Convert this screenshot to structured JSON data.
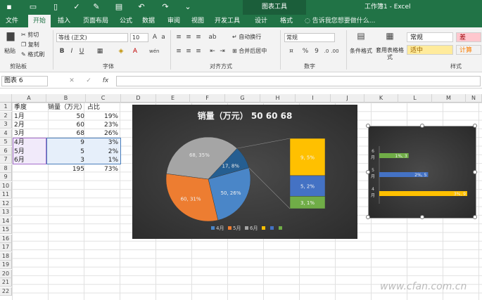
{
  "titlebar": {
    "chart_tools": "图表工具",
    "window_title": "工作簿1 - Excel"
  },
  "tabs": [
    {
      "label": "文件"
    },
    {
      "label": "开始"
    },
    {
      "label": "插入"
    },
    {
      "label": "页面布局"
    },
    {
      "label": "公式"
    },
    {
      "label": "数据"
    },
    {
      "label": "审阅"
    },
    {
      "label": "视图"
    },
    {
      "label": "开发工具"
    },
    {
      "label": "设计"
    },
    {
      "label": "格式"
    }
  ],
  "tellme": "告诉我您想要做什么...",
  "ribbon": {
    "clipboard": {
      "paste": "粘贴",
      "cut": "剪切",
      "copy": "复制",
      "format_painter": "格式刷",
      "label": "剪贴板"
    },
    "font": {
      "name": "等线 (正文)",
      "size": "10",
      "bold": "B",
      "italic": "I",
      "underline": "U",
      "label": "字体",
      "grow": "A",
      "wen": "wén"
    },
    "alignment": {
      "wrap": "自动换行",
      "merge": "合并后居中",
      "label": "对齐方式"
    },
    "number": {
      "format": "常规",
      "label": "数字",
      "percent": "%",
      "comma": "9"
    },
    "styles": {
      "conditional": "条件格式",
      "table": "套用表格格式",
      "normal": "常规",
      "bad": "差",
      "neutral": "适中",
      "calc": "计算",
      "label": "样式"
    }
  },
  "formula_bar": {
    "name_box": "图表 6",
    "cancel": "✕",
    "enter": "✓",
    "fx": "fx"
  },
  "columns": [
    "A",
    "B",
    "C",
    "D",
    "E",
    "F",
    "G",
    "H",
    "I",
    "J",
    "K",
    "L",
    "M",
    "N"
  ],
  "rows": [
    "1",
    "2",
    "3",
    "4",
    "5",
    "6",
    "7",
    "8",
    "9",
    "10",
    "11",
    "12",
    "13",
    "14",
    "15",
    "16",
    "17",
    "18",
    "19",
    "20",
    "21",
    "22"
  ],
  "sheet": {
    "header": {
      "a": "季度",
      "b": "销量（万元）",
      "c": "占比"
    },
    "data": [
      {
        "a": "1月",
        "b": "50",
        "c": "19%"
      },
      {
        "a": "2月",
        "b": "60",
        "c": "23%"
      },
      {
        "a": "3月",
        "b": "68",
        "c": "26%"
      },
      {
        "a": "4月",
        "b": "9",
        "c": "3%"
      },
      {
        "a": "5月",
        "b": "5",
        "c": "2%"
      },
      {
        "a": "6月",
        "b": "3",
        "c": "1%"
      }
    ],
    "total": {
      "b": "195",
      "c": "73%"
    }
  },
  "chart_data": [
    {
      "type": "pie",
      "title": "销量（万元） 50 60 68",
      "slices": [
        {
          "label": "50, 26%",
          "value": 50,
          "color": "#4a86c8"
        },
        {
          "label": "60, 31%",
          "value": 60,
          "color": "#ed7d31"
        },
        {
          "label": "68, 35%",
          "value": 68,
          "color": "#a5a5a5"
        },
        {
          "label": "17, 8%",
          "value": 17,
          "color": "#255e91"
        }
      ],
      "bar_of_pie": [
        {
          "label": "9, 5%",
          "value": 9,
          "color": "#ffc000"
        },
        {
          "label": "5, 2%",
          "value": 5,
          "color": "#4472c4"
        },
        {
          "label": "3, 1%",
          "value": 3,
          "color": "#70ad47"
        }
      ],
      "legend": [
        {
          "label": "4月",
          "color": "#4a86c8"
        },
        {
          "label": "5月",
          "color": "#ed7d31"
        },
        {
          "label": "6月",
          "color": "#a5a5a5"
        },
        {
          "label": "",
          "color": "#ffc000"
        },
        {
          "label": "",
          "color": "#4472c4"
        },
        {
          "label": "",
          "color": "#70ad47"
        }
      ],
      "legend_position": "bottom"
    },
    {
      "type": "bar",
      "categories": [
        "6月",
        "5月",
        "4月"
      ],
      "values": [
        3,
        5,
        9
      ],
      "labels": [
        "1%, 3",
        "2%, 5",
        "3%, 9"
      ],
      "colors": [
        "#70ad47",
        "#4472c4",
        "#ffc000"
      ],
      "xlim": [
        0,
        9
      ]
    }
  ],
  "watermark": "www.cfan.com.cn"
}
